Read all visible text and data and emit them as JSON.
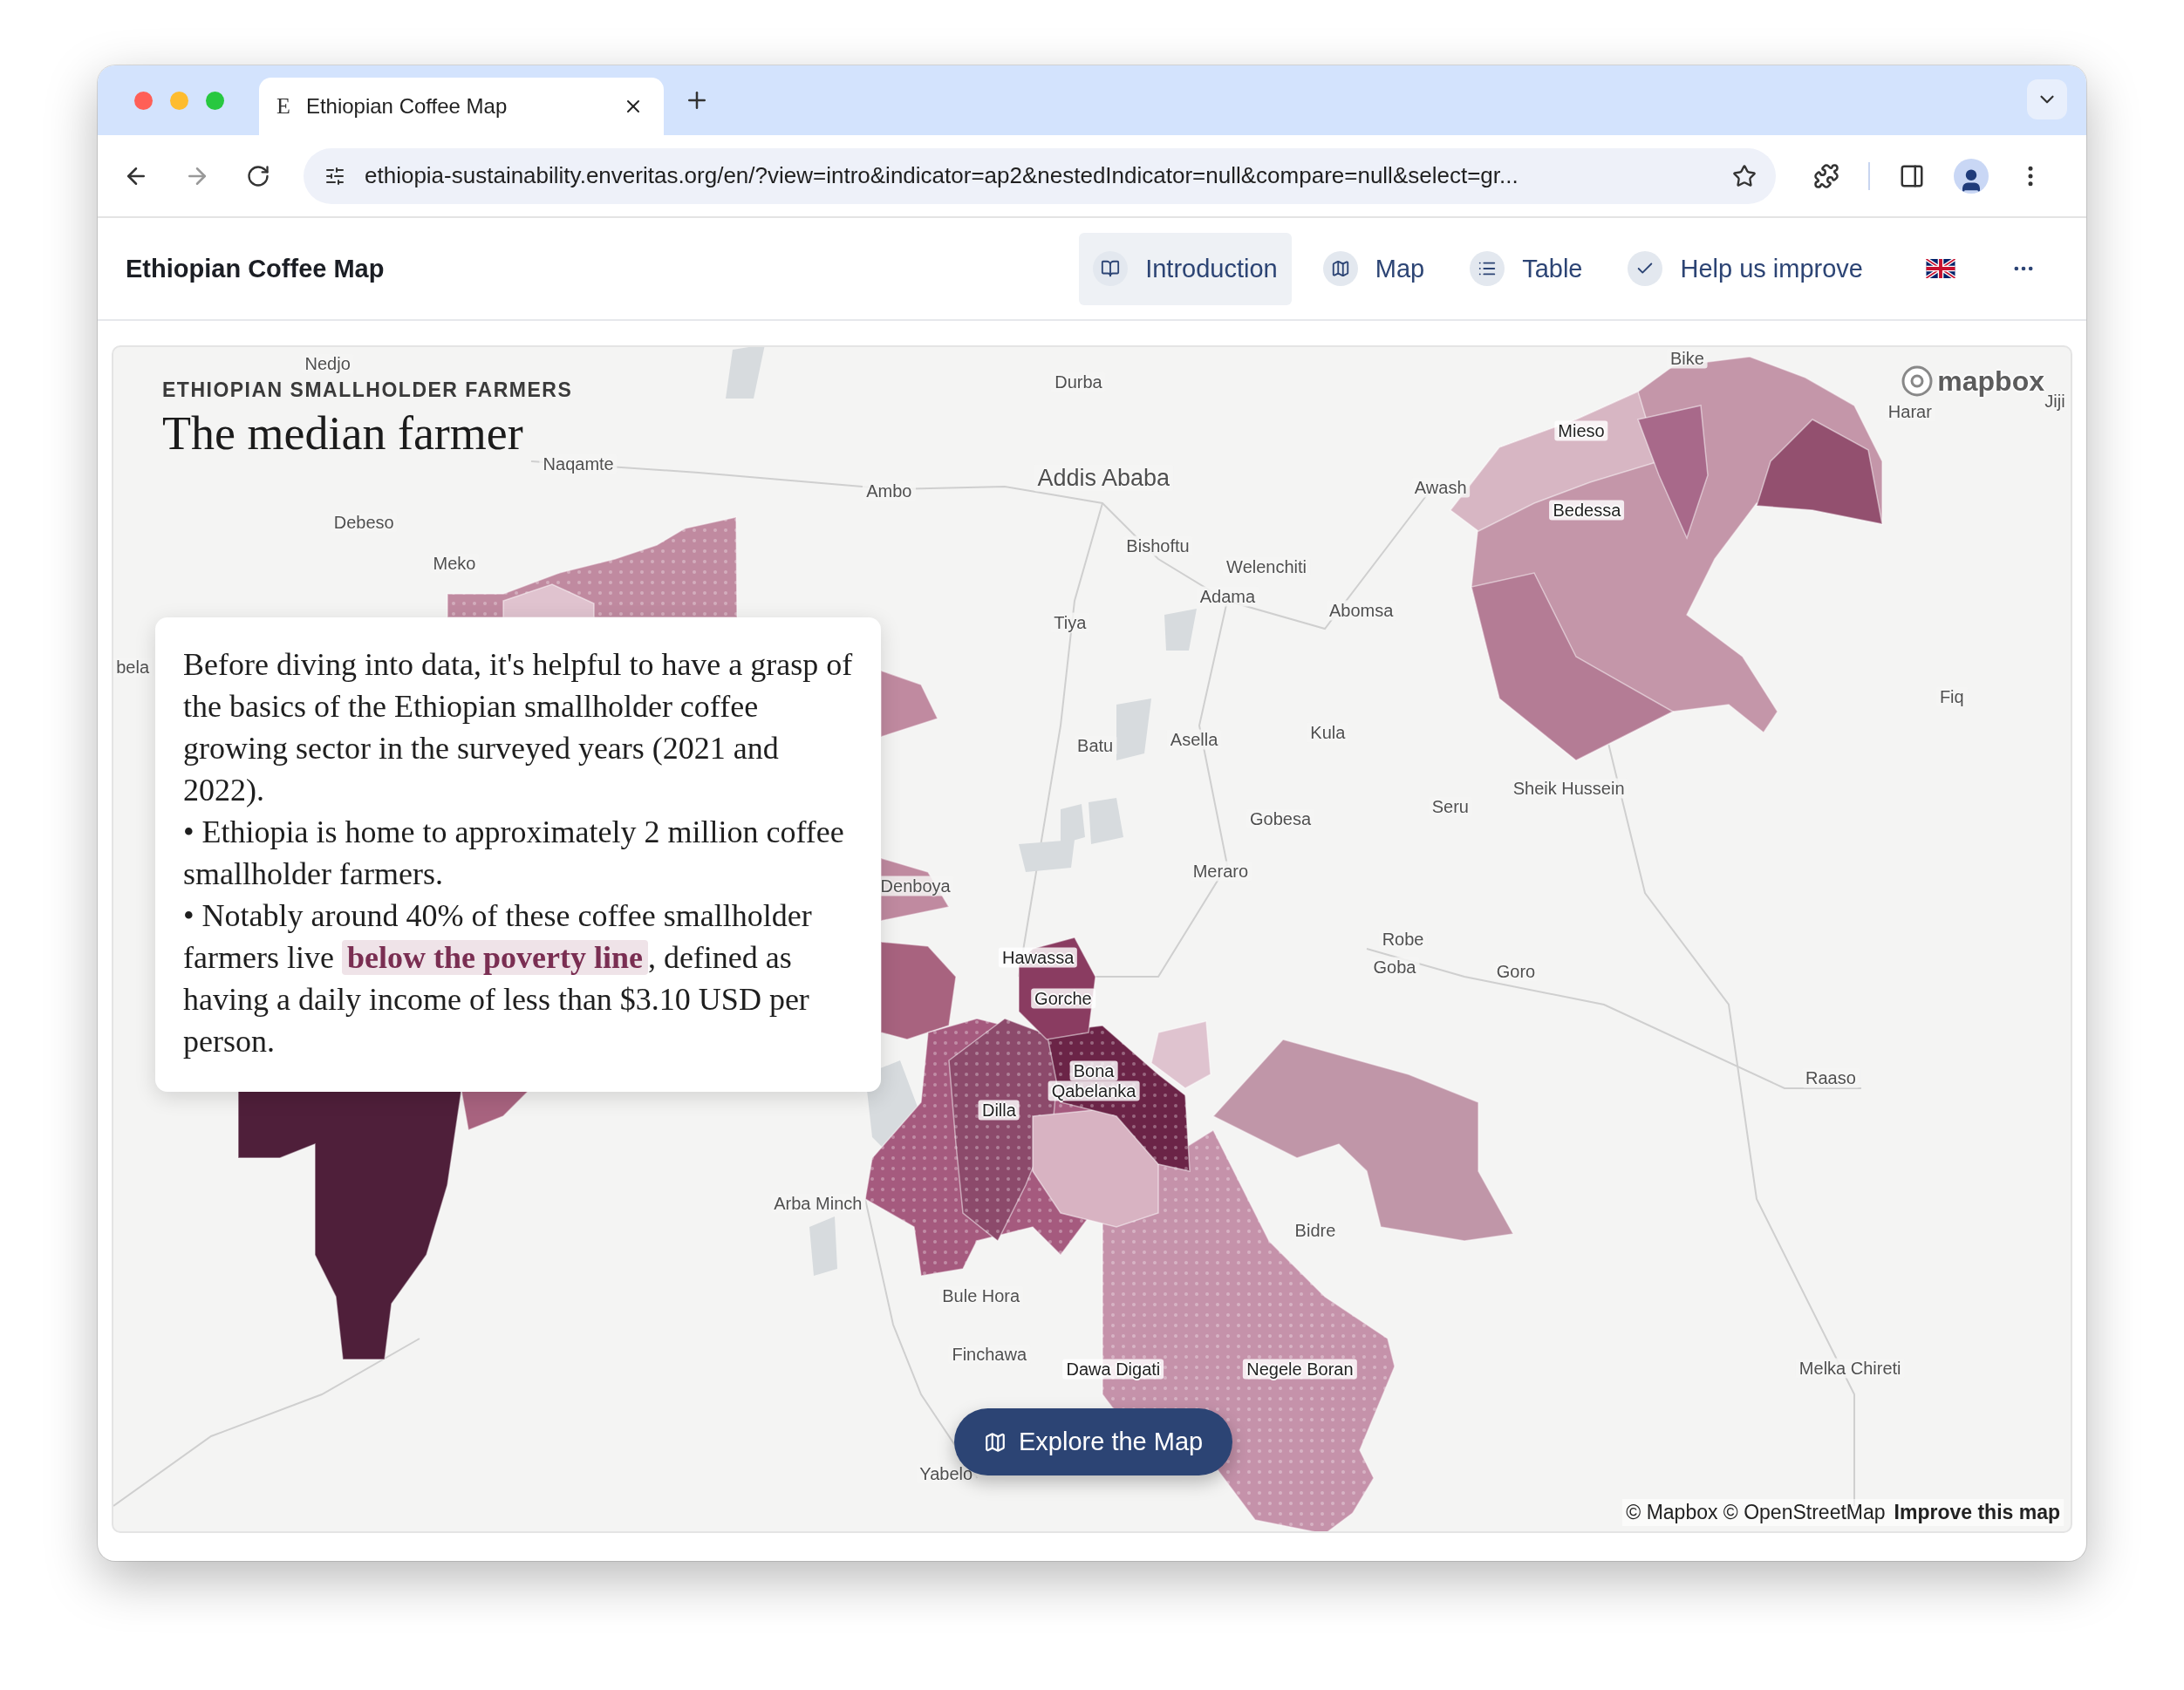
{
  "browser": {
    "tab": {
      "favicon": "E",
      "title": "Ethiopian Coffee Map",
      "selected": true
    },
    "url": "ethiopia-sustainability.enveritas.org/en/?view=intro&indicator=ap2&nestedIndicator=null&compare=null&select=gr..."
  },
  "header": {
    "brand": "Ethiopian Coffee Map",
    "nav": [
      {
        "label": "Introduction",
        "kind": "book",
        "selected": true
      },
      {
        "label": "Map",
        "kind": "map",
        "selected": false
      },
      {
        "label": "Table",
        "kind": "list",
        "selected": false
      },
      {
        "label": "Help us improve",
        "kind": "check",
        "selected": false
      }
    ]
  },
  "intro": {
    "eyebrow": "ETHIOPIAN SMALLHOLDER FARMERS",
    "title": "The median farmer",
    "paragraphs": [
      {
        "text": "Before diving into data, it's helpful to have a grasp of the basics of the Ethiopian smallholder coffee growing sector in the surveyed years (2021 and 2022)."
      },
      {
        "text": "• Ethiopia is home to approximately 2 million coffee smallholder farmers."
      },
      {
        "text": "• Notably around 40% of these coffee smallholder farmers live ",
        "link": "below the poverty line",
        "after": ", defined as having a daily income of less than $3.10 USD per person."
      }
    ]
  },
  "map": {
    "labels": [
      {
        "text": "Nedjo",
        "kind": "town"
      },
      {
        "text": "Durba",
        "kind": "town"
      },
      {
        "text": "Bike",
        "kind": "town"
      },
      {
        "text": "Mieso",
        "kind": "district"
      },
      {
        "text": "Harar",
        "kind": "town"
      },
      {
        "text": "Jiji",
        "kind": "town"
      },
      {
        "text": "Naqamte",
        "kind": "town"
      },
      {
        "text": "Ambo",
        "kind": "town"
      },
      {
        "text": "Addis Ababa",
        "kind": "capital"
      },
      {
        "text": "Awash",
        "kind": "town"
      },
      {
        "text": "Bedessa",
        "kind": "district"
      },
      {
        "text": "Debeso",
        "kind": "town"
      },
      {
        "text": "Meko",
        "kind": "town"
      },
      {
        "text": "Bishoftu",
        "kind": "town"
      },
      {
        "text": "Welenchiti",
        "kind": "town"
      },
      {
        "text": "Adama",
        "kind": "town"
      },
      {
        "text": "Abomsa",
        "kind": "town"
      },
      {
        "text": "Tiya",
        "kind": "town"
      },
      {
        "text": "bela",
        "kind": "town"
      },
      {
        "text": "Fiq",
        "kind": "town"
      },
      {
        "text": "Batu",
        "kind": "town"
      },
      {
        "text": "Asella",
        "kind": "town"
      },
      {
        "text": "Kula",
        "kind": "town"
      },
      {
        "text": "Sheik Hussein",
        "kind": "town"
      },
      {
        "text": "Seru",
        "kind": "town"
      },
      {
        "text": "Gobesa",
        "kind": "town"
      },
      {
        "text": "Meraro",
        "kind": "town"
      },
      {
        "text": "Denboya",
        "kind": "town"
      },
      {
        "text": "Robe",
        "kind": "town"
      },
      {
        "text": "Goba",
        "kind": "town"
      },
      {
        "text": "Goro",
        "kind": "town"
      },
      {
        "text": "Hawassa",
        "kind": "district"
      },
      {
        "text": "Gorche",
        "kind": "district"
      },
      {
        "text": "Raaso",
        "kind": "town"
      },
      {
        "text": "Bona",
        "kind": "district"
      },
      {
        "text": "Qabelanka",
        "kind": "district"
      },
      {
        "text": "Dilla",
        "kind": "district"
      },
      {
        "text": "Arba Minch",
        "kind": "town"
      },
      {
        "text": "Bidre",
        "kind": "town"
      },
      {
        "text": "Bule Hora",
        "kind": "town"
      },
      {
        "text": "Finchawa",
        "kind": "town"
      },
      {
        "text": "Dawa Digati",
        "kind": "district"
      },
      {
        "text": "Negele Boran",
        "kind": "district"
      },
      {
        "text": "Melka Chireti",
        "kind": "town"
      },
      {
        "text": "Yabelo",
        "kind": "town"
      }
    ],
    "logo": "mapbox",
    "explore_button": "Explore the Map",
    "attribution": "© Mapbox © OpenStreetMap",
    "improve_link": "Improve this map"
  }
}
